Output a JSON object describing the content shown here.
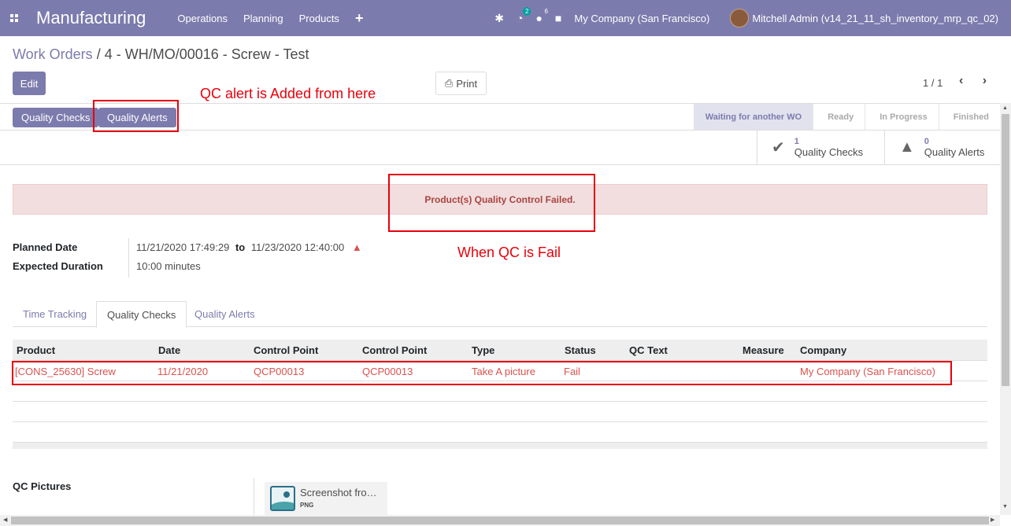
{
  "navbar": {
    "brand": "Manufacturing",
    "menu": [
      "Operations",
      "Planning",
      "Products"
    ],
    "plus": "+",
    "activity_badge": "2",
    "messages_badge": "6",
    "company": "My Company (San Francisco)",
    "user": "Mitchell Admin (v14_21_11_sh_inventory_mrp_qc_02)"
  },
  "breadcrumb": {
    "parent": "Work Orders",
    "separator": "/",
    "current": "4 - WH/MO/00016 - Screw - Test"
  },
  "actions": {
    "edit": "Edit",
    "print": "Print"
  },
  "pager": {
    "value": "1 / 1",
    "arrows": "‹ ›"
  },
  "annotations": {
    "qc_alert_note": "QC alert is Added from here",
    "qc_fail_note": "When QC is Fail"
  },
  "statusbar": {
    "buttons": [
      "Quality Checks",
      "Quality Alerts"
    ],
    "stages": [
      "Waiting for another WO",
      "Ready",
      "In Progress",
      "Finished"
    ],
    "active_stage": "Waiting for another WO"
  },
  "stat_buttons": [
    {
      "count": "1",
      "label": "Quality Checks",
      "icon": "check-icon"
    },
    {
      "count": "0",
      "label": "Quality Alerts",
      "icon": "warning-icon"
    }
  ],
  "alert": {
    "message": "Product(s) Quality Control Failed."
  },
  "fields": {
    "planned_date_label": "Planned Date",
    "planned_start": "11/21/2020 17:49:29",
    "to": "to",
    "planned_end": "11/23/2020 12:40:00",
    "expected_duration_label": "Expected Duration",
    "expected_duration_value": "10:00",
    "duration_unit": "minutes"
  },
  "tabs": [
    "Time Tracking",
    "Quality Checks",
    "Quality Alerts"
  ],
  "active_tab": "Quality Checks",
  "table": {
    "columns": [
      "Product",
      "Date",
      "Control Point",
      "Control Point",
      "Type",
      "Status",
      "QC Text",
      "Measure",
      "Company"
    ],
    "rows": [
      [
        "[CONS_25630] Screw",
        "11/21/2020",
        "QCP00013",
        "QCP00013",
        "Take A picture",
        "Fail",
        "",
        "",
        "My Company (San Francisco)"
      ]
    ]
  },
  "qc_pictures": {
    "label": "QC Pictures",
    "attachment_name": "Screenshot fro…",
    "attachment_ext": "PNG"
  },
  "colors": {
    "brand": "#7c7bad",
    "danger": "#d9534f",
    "annotation": "#e8000b",
    "alert_bg": "#f2dede"
  }
}
